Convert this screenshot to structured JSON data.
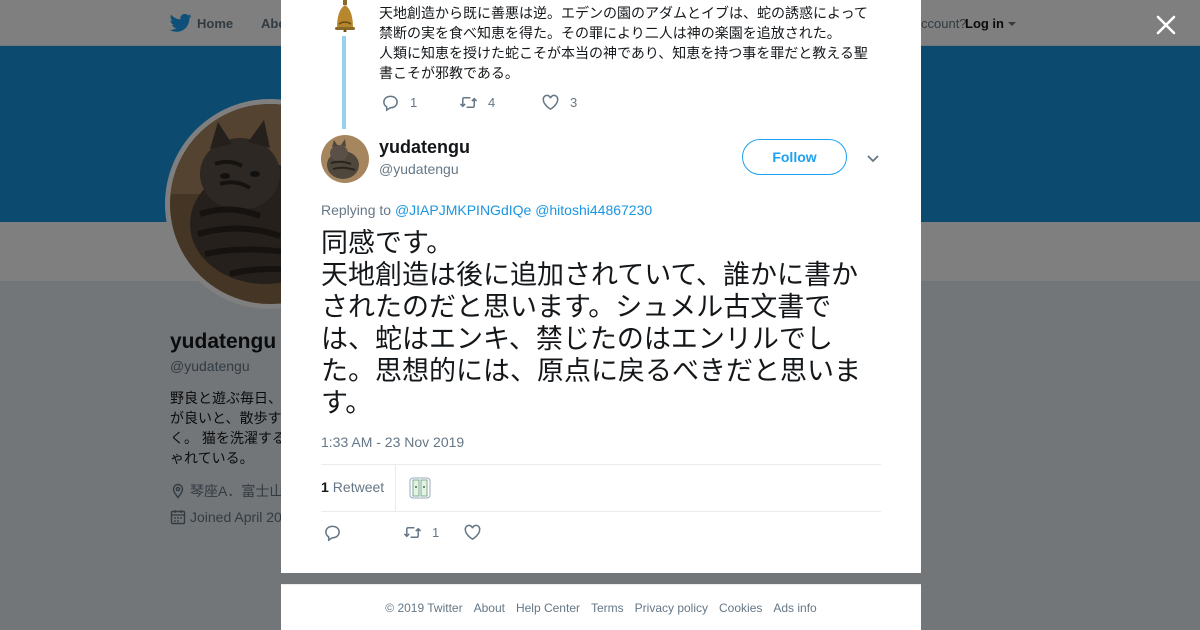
{
  "topbar": {
    "home_label": "Home",
    "about_label": "Abo",
    "account_prompt": "ccount?",
    "login_label": "Log in"
  },
  "profile": {
    "name": "yudatengu",
    "handle": "@yudatengu",
    "bio": "野良と遊ぶ毎日、\nが良いと、散歩す\nく。 猫を洗濯する\nゃれている。",
    "location": "琴座Α．富士山",
    "joined": "Joined April 20"
  },
  "prev_tweet": {
    "text": "天地創造から既に善悪は逆。エデンの園のアダムとイブは、蛇の誘惑によって\n禁断の実を食べ知恵を得た。その罪により二人は神の楽園を追放された。\n人類に知恵を授けた蛇こそが本当の神であり、知恵を持つ事を罪だと教える聖\n書こそが邪教である。",
    "replies": "1",
    "retweets": "4",
    "likes": "3"
  },
  "tweet": {
    "name": "yudatengu",
    "handle": "@yudatengu",
    "follow_label": "Follow",
    "replying_prefix": "Replying to",
    "reply_to_1": "@JIAPJMKPINGdIQe",
    "reply_to_2": "@hitoshi44867230",
    "text": "同感です。\n天地創造は後に追加されていて、誰かに書か\nされたのだと思います。シュメル古文書で\nは、蛇はエンキ、禁じたのはエンリルでし\nた。思想的には、原点に戻るべきだと思いま\nす。",
    "timestamp": "1:33 AM - 23 Nov 2019",
    "retweet_count": "1",
    "retweet_label": "Retweet",
    "action_retweets": "1"
  },
  "footer": {
    "copyright": "© 2019 Twitter",
    "links": [
      "About",
      "Help Center",
      "Terms",
      "Privacy policy",
      "Cookies",
      "Ads info"
    ]
  },
  "colors": {
    "twitter_blue": "#1da1f2",
    "banner": "#1b95e0",
    "thread_line": "#9ad0ef"
  }
}
